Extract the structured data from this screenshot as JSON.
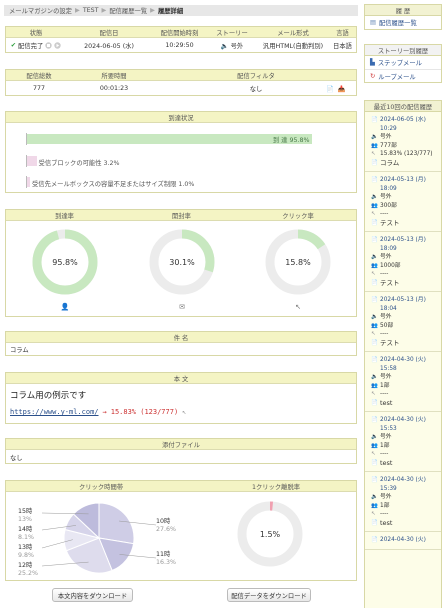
{
  "breadcrumb": {
    "items": [
      "メールマガジンの設定",
      "TEST",
      "配信履歴一覧",
      "履歴詳細"
    ]
  },
  "summary": {
    "headers": [
      "状態",
      "配信日",
      "配信開始時刻",
      "ストーリー",
      "メール形式",
      "言語"
    ],
    "status": "配信完了",
    "date": "2024-06-05 (水)",
    "start_time": "10:29:50",
    "story": "号外",
    "format": "汎用HTML(自動判別)",
    "language": "日本語"
  },
  "summary2": {
    "headers": [
      "配信総数",
      "所要時間",
      "配信フィルタ"
    ],
    "total": "777",
    "duration": "00:01:23",
    "filter": "なし"
  },
  "delivery": {
    "title": "到達状況",
    "bars": [
      {
        "label": "到 達 95.8%",
        "value": 95.8
      },
      {
        "label": "受信ブロックの可能性 3.2%",
        "value": 3.2
      },
      {
        "label": "受信先メールボックスの容量不足またはサイズ制限 1.0%",
        "value": 1.0
      }
    ]
  },
  "rates": [
    {
      "title": "到達率",
      "value": 95.8,
      "label": "95.8%",
      "color": "#c8e8c0",
      "icon": "person-icon"
    },
    {
      "title": "開封率",
      "value": 30.1,
      "label": "30.1%",
      "color": "#c8e8c0",
      "icon": "envelope-icon"
    },
    {
      "title": "クリック率",
      "value": 15.8,
      "label": "15.8%",
      "color": "#c8e8c0",
      "icon": "cursor-icon"
    }
  ],
  "subject": {
    "title": "件 名",
    "value": "コラム"
  },
  "body": {
    "title": "本 文",
    "text": "コラム用の例示です",
    "url": "https://www.y-ml.com/",
    "arrow": "→",
    "click_stat": "15.83% (123/777)"
  },
  "attachment": {
    "title": "添付ファイル",
    "value": "なし"
  },
  "click_time": {
    "title": "クリック時間帯",
    "slices": [
      {
        "hour": "10時",
        "pct": "27.6%",
        "value": 27.6
      },
      {
        "hour": "11時",
        "pct": "16.3%",
        "value": 16.3
      },
      {
        "hour": "12時",
        "pct": "25.2%",
        "value": 25.2
      },
      {
        "hour": "13時",
        "pct": "9.8%",
        "value": 9.8
      },
      {
        "hour": "14時",
        "pct": "8.1%",
        "value": 8.1
      },
      {
        "hour": "15時",
        "pct": "13%",
        "value": 13.0
      }
    ],
    "colors": [
      "#cfcde6",
      "#c4c2e0",
      "#dedced",
      "#e8e7f3",
      "#d6d4ea",
      "#bdbbdc"
    ]
  },
  "one_click": {
    "title": "1クリック離脱率",
    "value": 1.5,
    "label": "1.5%"
  },
  "buttons": {
    "download_body": "本文内容をダウンロード",
    "download_data": "配信データをダウンロード"
  },
  "sidebar": {
    "history_title": "履 歴",
    "history_link": "配信履歴一覧",
    "story_title": "ストーリー別履歴",
    "step_link": "ステップメール",
    "loop_link": "ループメール",
    "recent_title": "最近10回の配信履歴",
    "entries": [
      {
        "date": "2024-06-05 (水)",
        "time": "10:29",
        "story": "号外",
        "count": "777部",
        "rate": "15.83% (123/777)",
        "name": "コラム"
      },
      {
        "date": "2024-05-13 (月)",
        "time": "18:09",
        "story": "号外",
        "count": "300部",
        "rate": "----",
        "name": "テスト"
      },
      {
        "date": "2024-05-13 (月)",
        "time": "18:09",
        "story": "号外",
        "count": "1000部",
        "rate": "----",
        "name": "テスト"
      },
      {
        "date": "2024-05-13 (月)",
        "time": "18:04",
        "story": "号外",
        "count": "50部",
        "rate": "----",
        "name": "テスト"
      },
      {
        "date": "2024-04-30 (火)",
        "time": "15:58",
        "story": "号外",
        "count": "1部",
        "rate": "----",
        "name": "test"
      },
      {
        "date": "2024-04-30 (火)",
        "time": "15:53",
        "story": "号外",
        "count": "1部",
        "rate": "----",
        "name": "test"
      },
      {
        "date": "2024-04-30 (火)",
        "time": "15:39",
        "story": "号外",
        "count": "1部",
        "rate": "----",
        "name": "test"
      },
      {
        "date": "2024-04-30 (火)",
        "time": "",
        "story": "",
        "count": "",
        "rate": "",
        "name": ""
      }
    ]
  }
}
